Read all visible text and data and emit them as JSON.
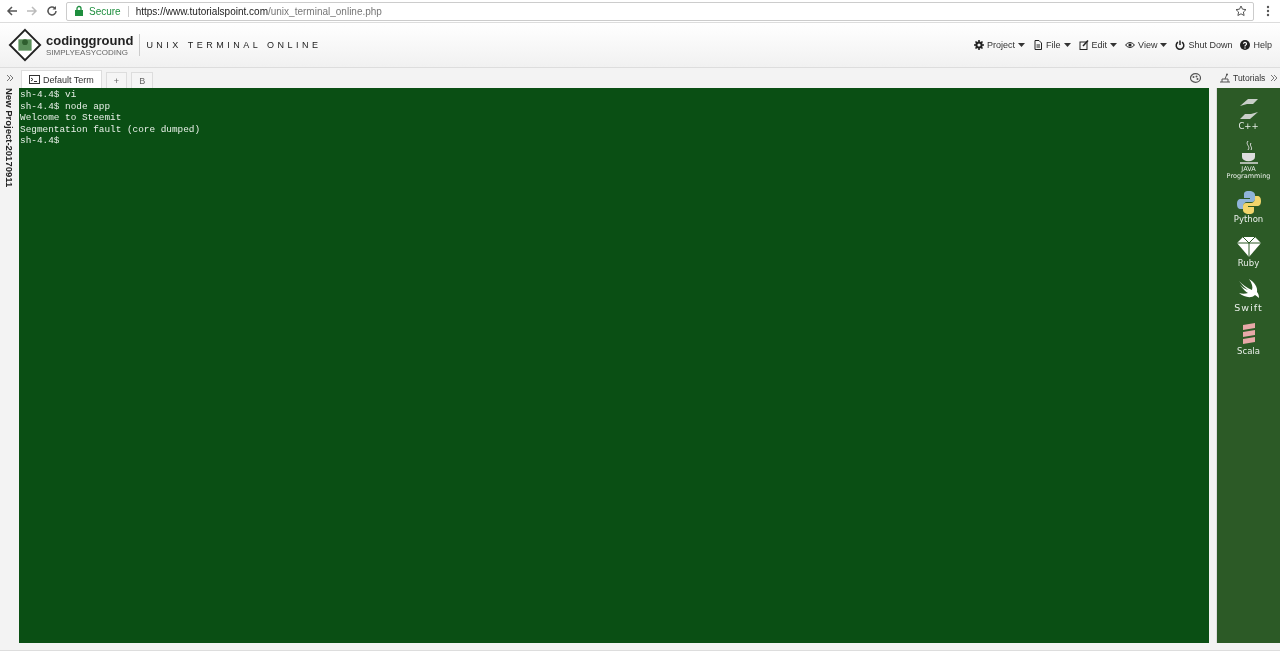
{
  "browser": {
    "secure_label": "Secure",
    "url_host": "https://www.tutorialspoint.com",
    "url_path": "/unix_terminal_online.php"
  },
  "header": {
    "logo_text": "codingground",
    "logo_tagline": "SIMPLYEASYCODING",
    "title": "UNIX TERMINAL ONLINE",
    "menu": [
      {
        "label": "Project",
        "dropdown": true
      },
      {
        "label": "File",
        "dropdown": true
      },
      {
        "label": "Edit",
        "dropdown": true
      },
      {
        "label": "View",
        "dropdown": true
      },
      {
        "label": "Shut Down",
        "dropdown": false
      },
      {
        "label": "Help",
        "dropdown": false
      }
    ]
  },
  "project": {
    "name": "New Project-20170911"
  },
  "tabs": [
    {
      "label": "Default Term",
      "selected": true
    },
    {
      "label": "+",
      "selected": false
    },
    {
      "label": "B",
      "selected": false
    }
  ],
  "terminal": {
    "lines": [
      "sh-4.4$ vi",
      "sh-4.4$ node app",
      "Welcome to Steemit",
      "Segmentation fault (core dumped)",
      "sh-4.4$"
    ]
  },
  "tutorials": {
    "title": "Tutorials",
    "items": [
      {
        "label": "C++"
      },
      {
        "label": "JAVA Programming"
      },
      {
        "label": "Python"
      },
      {
        "label": "Ruby"
      },
      {
        "label": "Swift"
      },
      {
        "label": "Scala"
      }
    ]
  }
}
